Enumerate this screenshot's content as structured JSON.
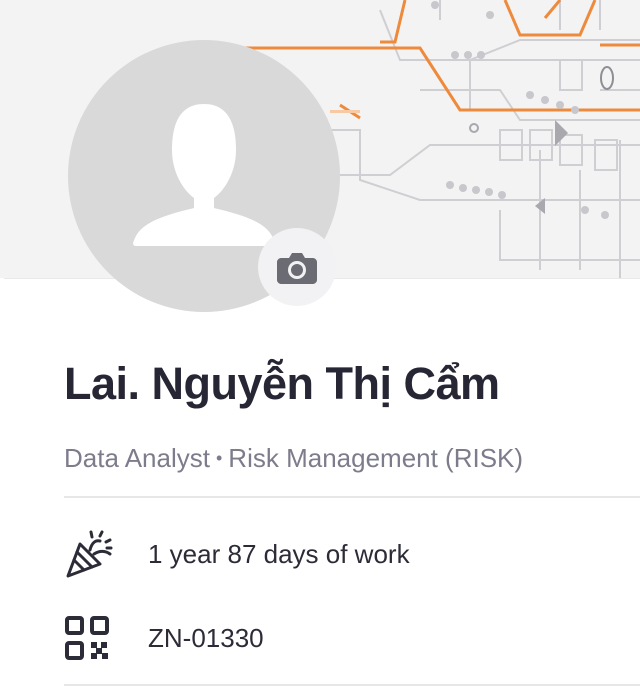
{
  "profile": {
    "name": "Lai. Nguyễn Thị Cẩm",
    "job_title": "Data Analyst",
    "separator": "•",
    "department": "Risk Management (RISK)"
  },
  "details": {
    "tenure": "1 year 87 days of work",
    "employee_code": "ZN-01330"
  },
  "icons": {
    "avatar": "default-user-avatar",
    "camera": "camera-icon",
    "tenure": "party-popper-icon",
    "code": "qr-code-icon"
  },
  "colors": {
    "name_text": "#262634",
    "subtitle_text": "#7c7c8c",
    "cover_accent": "#ee8a3c",
    "avatar_bg": "#d9d9da"
  }
}
